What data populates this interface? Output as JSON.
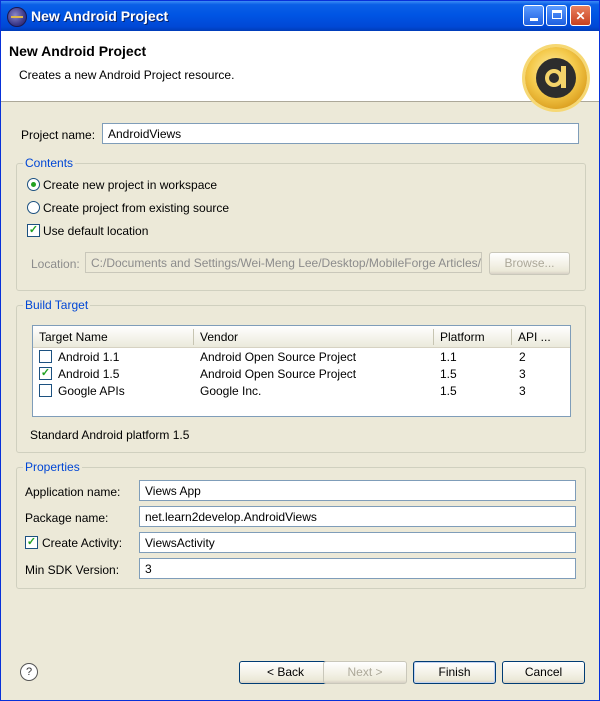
{
  "window": {
    "title": "New Android Project",
    "controls": [
      "minimize",
      "maximize",
      "close"
    ]
  },
  "header": {
    "title": "New Android Project",
    "subtitle": "Creates a new Android Project resource."
  },
  "project_name": {
    "label": "Project name:",
    "value": "AndroidViews"
  },
  "contents": {
    "title": "Contents",
    "create_new": "Create new project in workspace",
    "create_existing": "Create project from existing source",
    "use_default": "Use default location",
    "location_label": "Location:",
    "location_value": "C:/Documents and Settings/Wei-Meng Lee/Desktop/MobileForge Articles/",
    "browse": "Browse..."
  },
  "build_target": {
    "title": "Build Target",
    "columns": [
      "Target Name",
      "Vendor",
      "Platform",
      "API ..."
    ],
    "rows": [
      {
        "checked": false,
        "name": "Android 1.1",
        "vendor": "Android Open Source Project",
        "platform": "1.1",
        "api": "2"
      },
      {
        "checked": true,
        "name": "Android 1.5",
        "vendor": "Android Open Source Project",
        "platform": "1.5",
        "api": "3"
      },
      {
        "checked": false,
        "name": "Google APIs",
        "vendor": "Google Inc.",
        "platform": "1.5",
        "api": "3"
      }
    ],
    "description": "Standard Android platform 1.5"
  },
  "properties": {
    "title": "Properties",
    "app_name_label": "Application name:",
    "app_name": "Views App",
    "package_label": "Package name:",
    "package": "net.learn2develop.AndroidViews",
    "activity_label": "Create Activity:",
    "activity": "ViewsActivity",
    "minsdk_label": "Min SDK Version:",
    "minsdk": "3"
  },
  "footer": {
    "help": "?",
    "back": "< Back",
    "next": "Next >",
    "finish": "Finish",
    "cancel": "Cancel"
  }
}
